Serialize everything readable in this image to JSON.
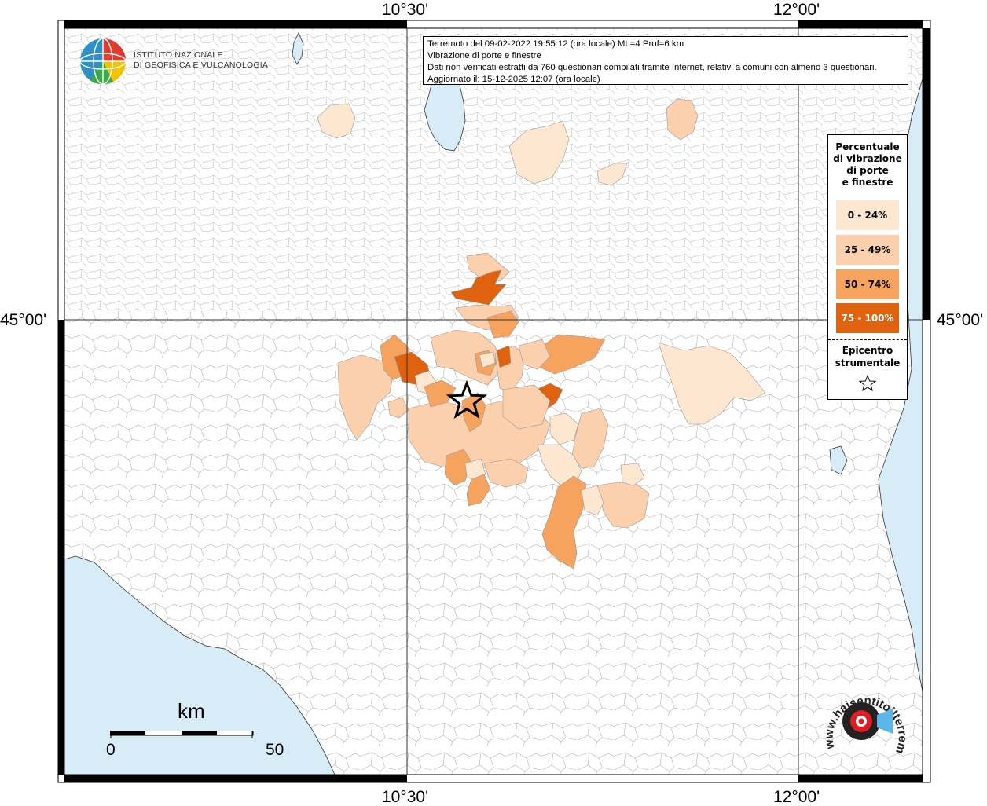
{
  "map": {
    "coord_labels": {
      "lon_1": "10°30'",
      "lon_2": "12°00'",
      "lat_1": "45°00'"
    },
    "info": {
      "line1": "Terremoto del 09-02-2022 19:55:12 (ora locale) ML=4 Prof=6 km",
      "line2": "Vibrazione di porte e finestre",
      "line3": "Dati non verificati estratti da 760 questionari compilati tramite Internet, relativi a comuni con almeno 3 questionari.",
      "line4": "Aggiornato il: 15-12-2025 12:07 (ora locale)"
    },
    "institute_logo_text": [
      "ISTITUTO NAZIONALE",
      "DI GEOFISICA E VULCANOLOGIA"
    ],
    "legend": {
      "title_lines": [
        "Percentuale",
        "di vibrazione",
        "di porte",
        "e finestre"
      ],
      "classes": [
        {
          "label": "0 - 24%",
          "color": "#fde7d1"
        },
        {
          "label": "25 - 49%",
          "color": "#fdd0ad"
        },
        {
          "label": "50 - 74%",
          "color": "#f5a35e"
        },
        {
          "label": "75 - 100%",
          "color": "#e0620f"
        }
      ],
      "epicenter_lines": [
        "Epicentro",
        "strumentale"
      ]
    },
    "scale": {
      "unit": "km",
      "start": "0",
      "end": "50"
    },
    "brand_logo_text": "www.haisentitoilterremoto.it",
    "colors": {
      "sea": "#d8ecf8",
      "boundary": "#9a9a9a",
      "grid": "#333333"
    }
  }
}
